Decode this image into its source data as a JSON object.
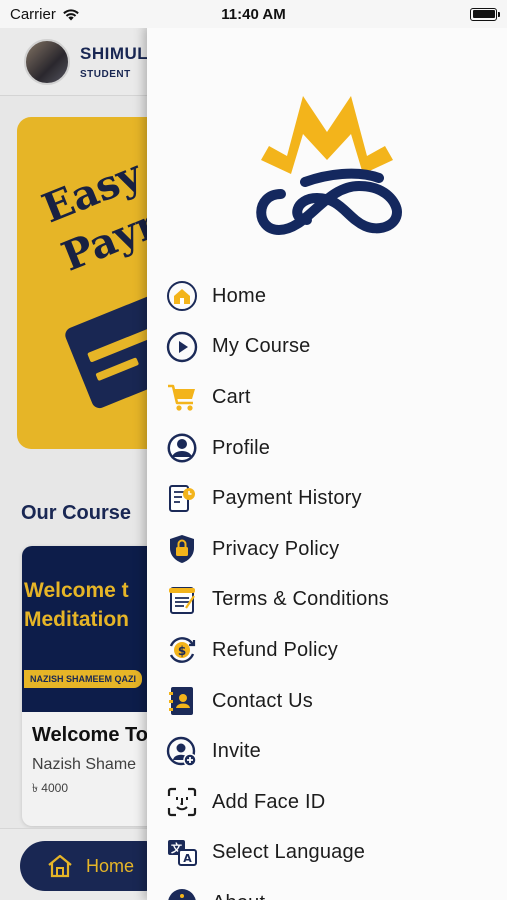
{
  "status_bar": {
    "carrier": "Carrier",
    "time": "11:40 AM"
  },
  "background_app": {
    "user": {
      "name": "SHIMUL",
      "role": "STUDENT"
    },
    "banner": {
      "line1": "Easy",
      "line2": "Paym"
    },
    "section_title": "Our Course",
    "course": {
      "thumb_line1": "Welcome t",
      "thumb_line2": "Meditation",
      "thumb_tag": "NAZISH SHAMEEM QAZI",
      "title": "Welcome To",
      "author": "Nazish Shame",
      "price": "৳ 4000"
    },
    "bottom_nav": {
      "home_label": "Home"
    }
  },
  "drawer": {
    "colors": {
      "navy": "#1b2a58",
      "gold": "#f3b41b"
    },
    "menu": [
      {
        "label": "Home",
        "icon": "home-icon"
      },
      {
        "label": "My Course",
        "icon": "play-icon"
      },
      {
        "label": "Cart",
        "icon": "cart-icon"
      },
      {
        "label": "Profile",
        "icon": "profile-icon"
      },
      {
        "label": "Payment History",
        "icon": "payment-history-icon"
      },
      {
        "label": "Privacy Policy",
        "icon": "privacy-shield-icon"
      },
      {
        "label": "Terms & Conditions",
        "icon": "terms-document-icon"
      },
      {
        "label": "Refund Policy",
        "icon": "refund-icon"
      },
      {
        "label": "Contact Us",
        "icon": "contact-book-icon"
      },
      {
        "label": "Invite",
        "icon": "invite-user-icon"
      },
      {
        "label": "Add Face ID",
        "icon": "face-id-icon"
      },
      {
        "label": "Select Language",
        "icon": "language-icon"
      },
      {
        "label": "About",
        "icon": "about-icon"
      }
    ]
  }
}
